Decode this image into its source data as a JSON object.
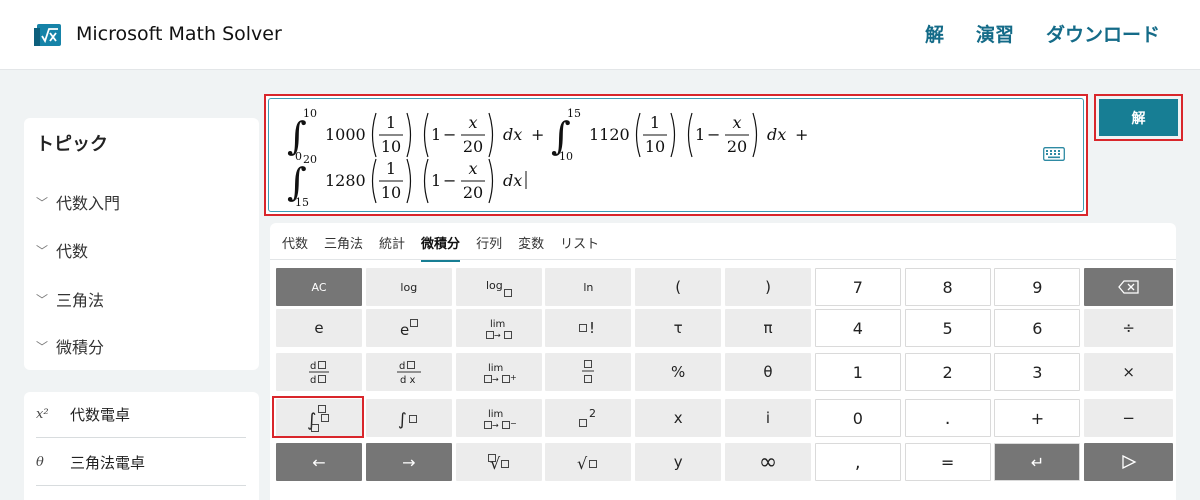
{
  "header": {
    "app_title": "Microsoft Math Solver",
    "nav": [
      "解",
      "演習",
      "ダウンロード"
    ],
    "brand_color": "#146b88"
  },
  "sidebar": {
    "topics_title": "トピック",
    "topics": [
      "代数入門",
      "代数",
      "三角法",
      "微積分"
    ],
    "calculators": [
      {
        "symbol": "x²",
        "label": "代数電卓"
      },
      {
        "symbol": "θ",
        "label": "三角法電卓"
      }
    ]
  },
  "input": {
    "expression_line1": "∫₀¹⁰ 1000 (1/10) (1 − x/20) dx + ∫₁₀¹⁵ 1120 (1/10) (1 − x/20) dx +",
    "expression_line2": "∫₁₅²⁰ 1280 (1/10) (1 − x/20) dx",
    "terms": [
      {
        "lower": "0",
        "upper": "10",
        "coef": "1000"
      },
      {
        "lower": "10",
        "upper": "15",
        "coef": "1120"
      },
      {
        "lower": "15",
        "upper": "20",
        "coef": "1280"
      }
    ],
    "fraction": {
      "num": "1",
      "den": "10"
    },
    "x_fraction": {
      "num": "x",
      "den": "20"
    },
    "one": "1",
    "minus": "−",
    "plus": "+",
    "dx": "dx",
    "keyboard_icon": "keyboard-icon"
  },
  "solve_button": "解",
  "keypad": {
    "tabs": [
      "代数",
      "三角法",
      "統計",
      "微積分",
      "行列",
      "変数",
      "リスト"
    ],
    "active_tab": "微積分",
    "rows": [
      [
        "AC",
        "log",
        "log□",
        "ln",
        "(",
        ")",
        "7",
        "8",
        "9",
        "⌫"
      ],
      [
        "e",
        "e□",
        "lim □→□",
        "□!",
        "τ",
        "π",
        "4",
        "5",
        "6",
        "÷"
      ],
      [
        "d□/d□",
        "d□/dx",
        "lim □→□⁺",
        "□/□",
        "%",
        "θ",
        "1",
        "2",
        "3",
        "×"
      ],
      [
        "∫□□ □",
        "∫□",
        "lim □→□⁻",
        "□²",
        "x",
        "i",
        "0",
        ".",
        "+",
        "−"
      ],
      [
        "←",
        "→",
        "∜□",
        "√□",
        "y",
        "∞",
        ",",
        "=",
        "↵",
        "▷"
      ]
    ]
  }
}
